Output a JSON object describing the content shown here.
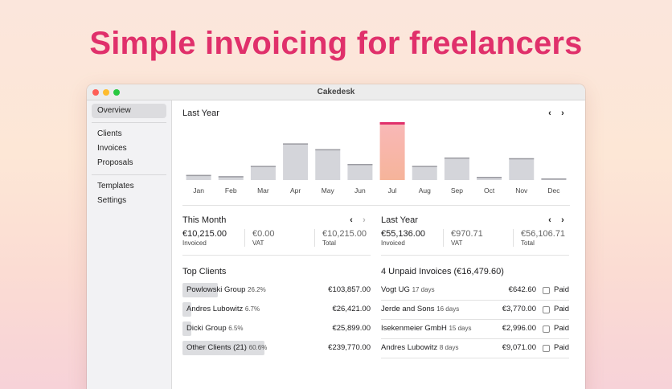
{
  "hero": {
    "headline": "Simple invoicing for freelancers"
  },
  "window": {
    "title": "Cakedesk"
  },
  "sidebar": {
    "items": [
      {
        "label": "Overview",
        "active": true
      },
      {
        "label": "Clients"
      },
      {
        "label": "Invoices"
      },
      {
        "label": "Proposals"
      },
      {
        "label": "Templates"
      },
      {
        "label": "Settings"
      }
    ]
  },
  "chart_data": {
    "type": "bar",
    "title": "Last Year",
    "categories": [
      "Jan",
      "Feb",
      "Mar",
      "Apr",
      "May",
      "Jun",
      "Jul",
      "Aug",
      "Sep",
      "Oct",
      "Nov",
      "Dec"
    ],
    "values": [
      8,
      6,
      22,
      57,
      48,
      25,
      90,
      22,
      35,
      5,
      34,
      2
    ],
    "highlight_index": 6,
    "colors": {
      "bar": "#d4d5da",
      "bar_top": "#9c9ca2",
      "highlight_top": "#f9b8b8",
      "highlight_bottom": "#f6b49a",
      "highlight_cap": "#e0306b"
    }
  },
  "this_month": {
    "title": "This Month",
    "stats": [
      {
        "value": "€10,215.00",
        "label": "Invoiced"
      },
      {
        "value": "€0.00",
        "label": "VAT"
      },
      {
        "value": "€10,215.00",
        "label": "Total"
      }
    ]
  },
  "last_year": {
    "title": "Last Year",
    "stats": [
      {
        "value": "€55,136.00",
        "label": "Invoiced"
      },
      {
        "value": "€970.71",
        "label": "VAT"
      },
      {
        "value": "€56,106.71",
        "label": "Total"
      }
    ]
  },
  "top_clients": {
    "title": "Top Clients",
    "rows": [
      {
        "name": "Powlowski Group",
        "pct": "26.2%",
        "share": 0.262,
        "amount": "€103,857.00"
      },
      {
        "name": "Andres Lubowitz",
        "pct": "6.7%",
        "share": 0.067,
        "amount": "€26,421.00"
      },
      {
        "name": "Dicki Group",
        "pct": "6.5%",
        "share": 0.065,
        "amount": "€25,899.00"
      },
      {
        "name": "Other Clients (21)",
        "pct": "60.6%",
        "share": 0.606,
        "amount": "€239,770.00"
      }
    ]
  },
  "unpaid": {
    "title": "4 Unpaid Invoices (€16,479.60)",
    "paid_label": "Paid",
    "rows": [
      {
        "name": "Vogt UG",
        "days": "17 days",
        "amount": "€642.60"
      },
      {
        "name": "Jerde and Sons",
        "days": "16 days",
        "amount": "€3,770.00"
      },
      {
        "name": "Isekenmeier GmbH",
        "days": "15 days",
        "amount": "€2,996.00"
      },
      {
        "name": "Andres Lubowitz",
        "days": "8 days",
        "amount": "€9,071.00"
      }
    ]
  },
  "icons": {
    "prev": "chevron-left-icon",
    "next": "chevron-right-icon"
  },
  "glyphs": {
    "prev": "‹",
    "next": "›"
  }
}
